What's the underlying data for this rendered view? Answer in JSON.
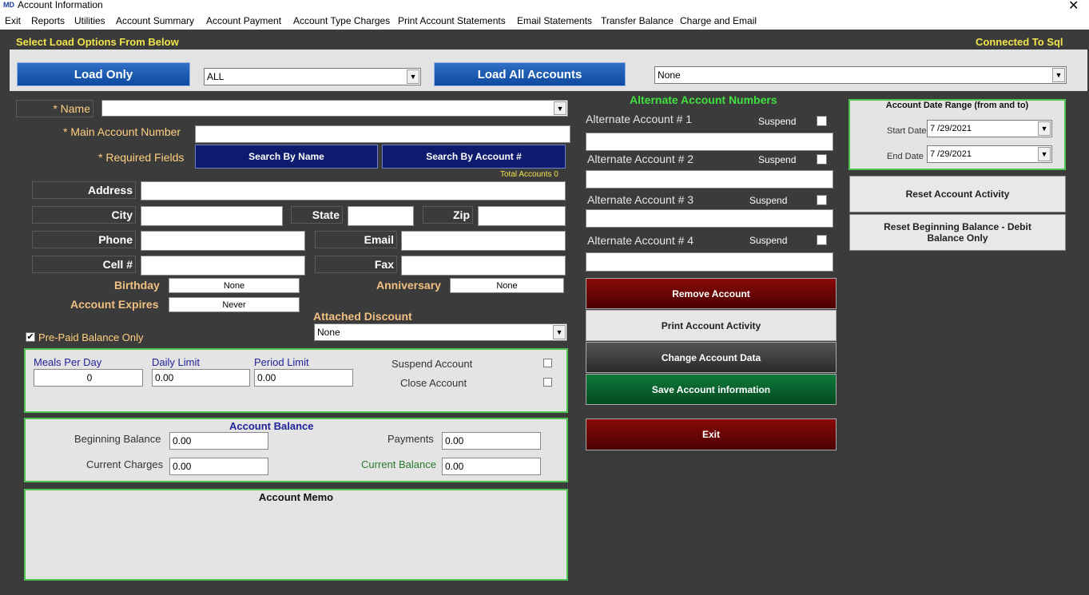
{
  "window": {
    "title": "Account Information",
    "close_glyph": "✕"
  },
  "menu": [
    "Exit",
    "Reports",
    "Utilities",
    "Account Summary",
    "Account Payment",
    "Account Type Charges",
    "Print Account Statements",
    "Email Statements",
    "Transfer Balance",
    "Charge and Email"
  ],
  "header": {
    "load_options": "Select  Load Options From Below",
    "connection": "Connected To Sql"
  },
  "load": {
    "load_only": "Load Only",
    "load_filter": "ALL",
    "load_all": "Load All Accounts",
    "account_select": "None"
  },
  "account": {
    "name_label": "* Name",
    "name_value": "",
    "main_number_label": "* Main Account Number",
    "main_number_value": "",
    "required_label": "* Required Fields",
    "search_name": "Search By Name",
    "search_account": "Search By Account #",
    "total_accounts": "Total Accounts 0",
    "address_label": "Address",
    "city_label": "City",
    "state_label": "State",
    "zip_label": "Zip",
    "phone_label": "Phone",
    "email_label": "Email",
    "cell_label": "Cell #",
    "fax_label": "Fax",
    "birthday_label": "Birthday",
    "birthday_value": "None",
    "anniversary_label": "Anniversary",
    "anniversary_value": "None",
    "expires_label": "Account Expires",
    "expires_value": "Never",
    "discount_label": "Attached Discount",
    "discount_value": "None",
    "prepaid_label": "Pre-Paid Balance Only",
    "prepaid_checked": true
  },
  "limits": {
    "meals_label": "Meals Per Day",
    "meals_value": "0",
    "daily_label": "Daily Limit",
    "daily_value": "0.00",
    "period_label": "Period Limit",
    "period_value": "0.00",
    "suspend_label": "Suspend Account",
    "close_label": "Close Account"
  },
  "balance": {
    "title": "Account Balance",
    "beginning_label": "Beginning Balance",
    "beginning_value": "0.00",
    "payments_label": "Payments",
    "payments_value": "0.00",
    "charges_label": "Current Charges",
    "charges_value": "0.00",
    "current_label": "Current Balance",
    "current_value": "0.00"
  },
  "memo": {
    "title": "Account Memo"
  },
  "alternate": {
    "title": "Alternate Account Numbers",
    "items": [
      {
        "label": "Alternate Account # 1",
        "suspend": "Suspend"
      },
      {
        "label": "Alternate Account # 2",
        "suspend": "Suspend"
      },
      {
        "label": "Alternate Account # 3",
        "suspend": "Suspend"
      },
      {
        "label": "Alternate Account # 4",
        "suspend": "Suspend"
      }
    ]
  },
  "actions": {
    "remove": "Remove Account",
    "print": "Print Account Activity",
    "change": "Change Account Data",
    "save": "Save Account information",
    "exit": "Exit"
  },
  "date_range": {
    "title": "Account Date Range (from and to)",
    "start_label": "Start Date",
    "start_value": "7 /29/2021",
    "end_label": "End Date",
    "end_value": "7 /29/2021"
  },
  "reset": {
    "activity": "Reset Account Activity",
    "beginning": "Reset Beginning Balance - Debit Balance Only"
  },
  "colors": {
    "background": "#3c3b3c",
    "accent_green": "#3fe03f",
    "yellow": "#f0e54a",
    "navy": "#0d1a6e",
    "dark_red": "#6a0000",
    "dark_green": "#0a5a2a"
  },
  "icons": {
    "app": "app-logo-icon",
    "dropdown": "chevron-down-icon",
    "check": "checkmark-icon"
  }
}
